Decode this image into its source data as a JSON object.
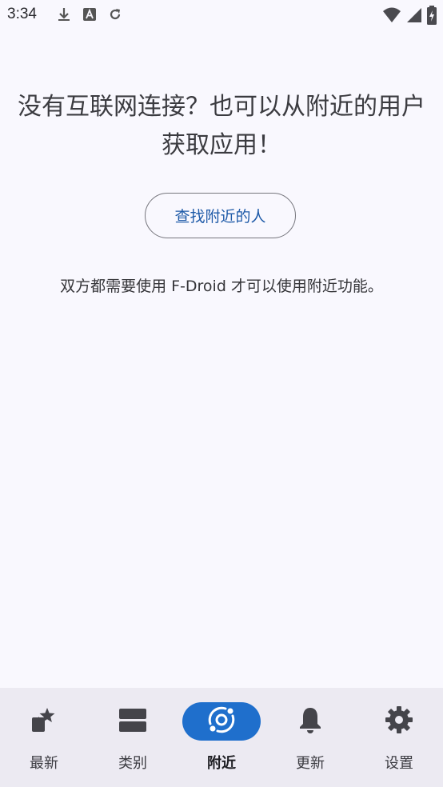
{
  "status_bar": {
    "time": "3:34",
    "left_icons": [
      "download-icon",
      "font-a-icon",
      "refresh-icon"
    ],
    "right_icons": [
      "wifi-icon",
      "signal-icon",
      "battery-charging-icon"
    ]
  },
  "main": {
    "headline": "没有互联网连接？也可以从附近的用户获取应用！",
    "find_button_label": "查找附近的人",
    "info_text": "双方都需要使用 F-Droid 才可以使用附近功能。"
  },
  "bottom_nav": {
    "items": [
      {
        "label": "最新",
        "icon": "star-sparkle-icon"
      },
      {
        "label": "类别",
        "icon": "categories-icon"
      },
      {
        "label": "附近",
        "icon": "nearby-icon",
        "active": true
      },
      {
        "label": "更新",
        "icon": "bell-icon"
      },
      {
        "label": "设置",
        "icon": "gear-icon"
      }
    ],
    "active_color": "#1f6fcc"
  }
}
